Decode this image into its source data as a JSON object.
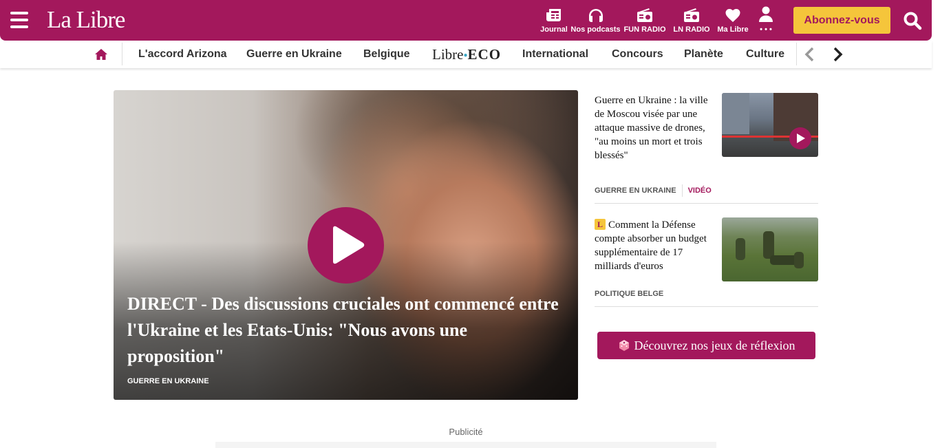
{
  "brand": {
    "logo_text": "La Libre",
    "primary_color": "#a3185c",
    "accent_color": "#f5c53b"
  },
  "header": {
    "nav_icons": [
      {
        "label": "Journal",
        "icon": "newspaper-icon"
      },
      {
        "label": "Nos podcasts",
        "icon": "headphones-icon"
      },
      {
        "label": "FUN RADIO",
        "icon": "radio-icon"
      },
      {
        "label": "LN RADIO",
        "icon": "radio-icon"
      },
      {
        "label": "Ma Libre",
        "icon": "heart-icon"
      },
      {
        "label": "• • •",
        "icon": "user-icon"
      }
    ],
    "subscribe_label": "Abonnez-vous"
  },
  "categories": {
    "items": [
      "L'accord Arizona",
      "Guerre en Ukraine",
      "Belgique",
      "International",
      "Concours",
      "Planète",
      "Culture"
    ],
    "libre_eco": {
      "part1": "Libre",
      "part2": "ECO"
    }
  },
  "hero": {
    "title": "DIRECT - Des discussions cruciales ont commencé entre l'Ukraine et les Etats-Unis: \"Nous avons une proposition\"",
    "tag": "GUERRE EN UKRAINE"
  },
  "side_articles": [
    {
      "title": "Guerre en Ukraine : la ville de Moscou visée par une attaque massive de drones, \"au moins un mort et trois blessés\"",
      "tag": "GUERRE EN UKRAINE",
      "tag2": "VIDÉO"
    },
    {
      "badge": "L",
      "title": "Comment la Défense compte absorber un budget supplémentaire de 17 milliards d'euros",
      "tag": "POLITIQUE BELGE"
    }
  ],
  "games_button_label": "Découvrez nos jeux de réflexion",
  "ad": {
    "label": "Publicité"
  }
}
